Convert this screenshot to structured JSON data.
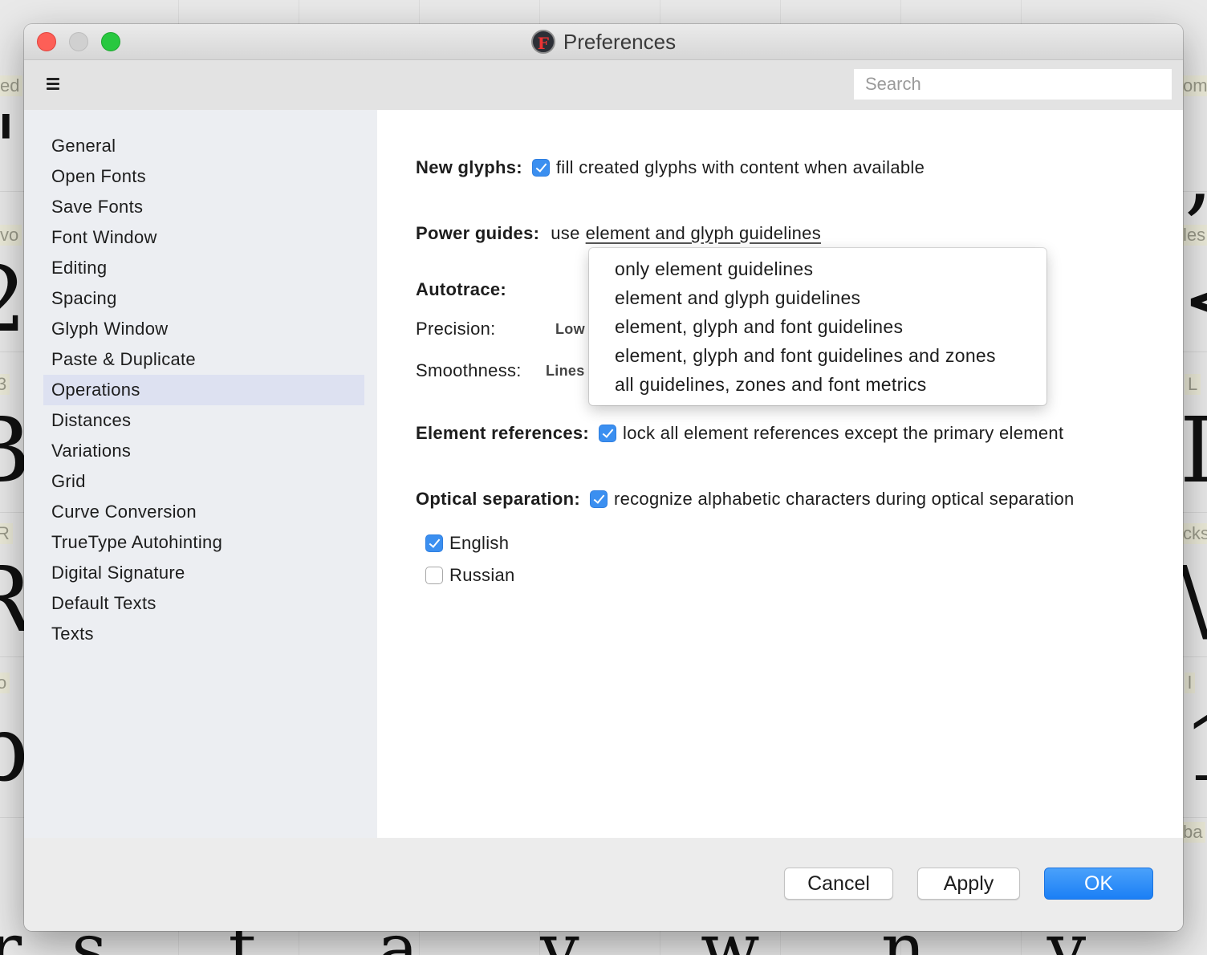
{
  "background": {
    "labels": [
      "ed",
      "vo",
      "3",
      "R",
      "o",
      "om",
      "les",
      "L",
      "cks",
      "l",
      "ba"
    ],
    "glyphs": [
      "'",
      "2",
      "B",
      "R",
      "b",
      ",",
      "<",
      "I",
      "\\",
      "1"
    ],
    "bottom_row": "rs t a v w n y z {"
  },
  "window": {
    "title": "Preferences",
    "app_icon_letter": "F"
  },
  "toolbar": {
    "search_placeholder": "Search"
  },
  "sidebar": {
    "items": [
      {
        "label": "General"
      },
      {
        "label": "Open Fonts"
      },
      {
        "label": "Save Fonts"
      },
      {
        "label": "Font Window"
      },
      {
        "label": "Editing"
      },
      {
        "label": "Spacing"
      },
      {
        "label": "Glyph Window"
      },
      {
        "label": "Paste & Duplicate"
      },
      {
        "label": "Operations",
        "selected": true
      },
      {
        "label": "Distances"
      },
      {
        "label": "Variations"
      },
      {
        "label": "Grid"
      },
      {
        "label": "Curve Conversion"
      },
      {
        "label": "TrueType Autohinting"
      },
      {
        "label": "Digital Signature"
      },
      {
        "label": "Default Texts"
      },
      {
        "label": "Texts"
      }
    ]
  },
  "content": {
    "new_glyphs": {
      "label": "New glyphs:",
      "checked": true,
      "text": "fill created glyphs with content when available"
    },
    "power_guides": {
      "label": "Power guides:",
      "prefix": "use",
      "value": "element and glyph guidelines",
      "options": [
        "only element guidelines",
        "element and glyph guidelines",
        "element, glyph and font guidelines",
        "element, glyph and font guidelines and zones",
        "all guidelines, zones and font metrics"
      ]
    },
    "autotrace": {
      "label": "Autotrace:",
      "precision_label": "Precision:",
      "precision_value": "Low",
      "smoothness_label": "Smoothness:",
      "smoothness_value": "Lines"
    },
    "element_references": {
      "label": "Element references:",
      "checked": true,
      "text": "lock all element references except the primary element"
    },
    "optical_separation": {
      "label": "Optical separation:",
      "checked": true,
      "text": "recognize alphabetic characters during optical separation",
      "languages": [
        {
          "label": "English",
          "checked": true
        },
        {
          "label": "Russian",
          "checked": false
        }
      ]
    }
  },
  "footer": {
    "cancel_label": "Cancel",
    "apply_label": "Apply",
    "ok_label": "OK"
  },
  "colors": {
    "accent": "#3b8ff0",
    "sidebar_bg": "#eceef2",
    "sidebar_selected": "#dde1f1"
  }
}
